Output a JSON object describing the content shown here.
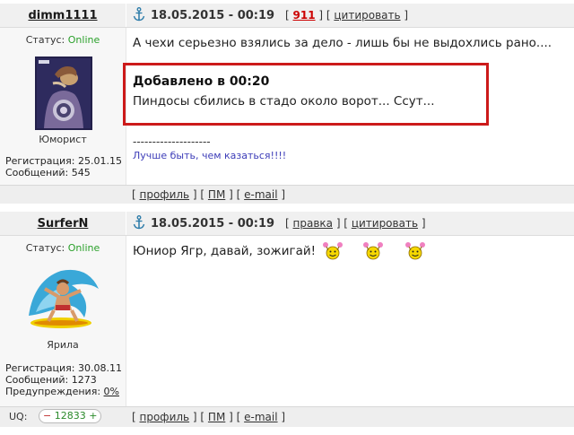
{
  "post1": {
    "nick": "dimm1111",
    "date": "18.05.2015 - 00:19",
    "post_num": "911",
    "quote_label": "цитировать",
    "status_label": "Статус:",
    "status_value": "Online",
    "rank": "Юморист",
    "reg_label": "Регистрация: 25.01.15",
    "msgs_label": "Сообщений: 545",
    "text": "А чехи серьезно взялись за дело - лишь бы не выдохлись рано....",
    "added_title": "Добавлено в 00:20",
    "added_text": "Пиндосы сбились в стадо около ворот... Ссут...",
    "sig_line": "--------------------",
    "signature": "Лучше быть, чем казаться!!!!",
    "footer": {
      "profile": "профиль",
      "pm": "ПМ",
      "email": "e-mail"
    }
  },
  "post2": {
    "nick": "SurferN",
    "date": "18.05.2015 - 00:19",
    "edit_label": "правка",
    "quote_label": "цитировать",
    "status_label": "Статус:",
    "status_value": "Online",
    "rank": "Ярила",
    "reg_label": "Регистрация: 30.08.11",
    "msgs_label": "Сообщений: 1273",
    "warn_label": "Предупреждения:",
    "warn_value": "0%",
    "text": "Юниор Ягр, давай, зожигай!",
    "uq_label": "UQ:",
    "uq_value": "12833",
    "footer": {
      "profile": "профиль",
      "pm": "ПМ",
      "email": "e-mail"
    }
  },
  "colors": {
    "highlight_border": "#cc1a1a",
    "online": "#2aa02a",
    "signature": "#3d3db8"
  },
  "icons": {
    "anchor": "anchor-icon",
    "smiley": "cheering-smiley-icon"
  }
}
